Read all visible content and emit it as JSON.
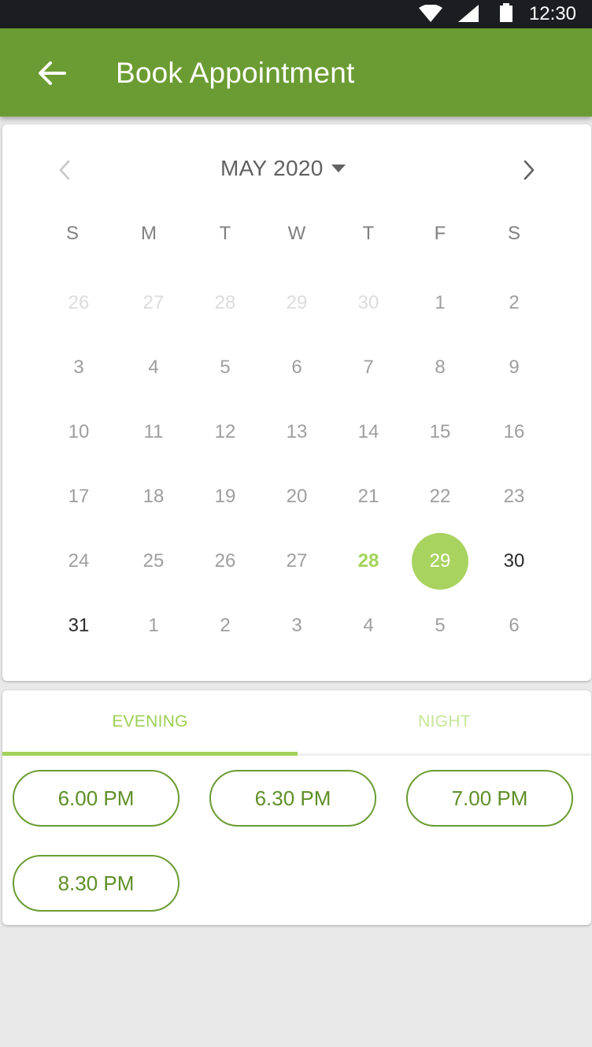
{
  "status_bar": {
    "time": "12:30",
    "icons": [
      "wifi-icon",
      "signal-icon",
      "battery-icon"
    ]
  },
  "app_bar": {
    "title": "Book Appointment",
    "back_icon": "arrow-left-icon"
  },
  "calendar": {
    "month_label": "MAY 2020",
    "weekdays": [
      "S",
      "M",
      "T",
      "W",
      "T",
      "F",
      "S"
    ],
    "weeks": [
      [
        "26",
        "27",
        "28",
        "29",
        "30",
        "1",
        "2"
      ],
      [
        "3",
        "4",
        "5",
        "6",
        "7",
        "8",
        "9"
      ],
      [
        "10",
        "11",
        "12",
        "13",
        "14",
        "15",
        "16"
      ],
      [
        "17",
        "18",
        "19",
        "20",
        "21",
        "22",
        "23"
      ],
      [
        "24",
        "25",
        "26",
        "27",
        "28",
        "29",
        "30"
      ],
      [
        "31",
        "1",
        "2",
        "3",
        "4",
        "5",
        "6"
      ]
    ],
    "today": "28",
    "selected": "29",
    "enabled_days": [
      "30",
      "31"
    ]
  },
  "tabs": [
    {
      "label": "EVENING",
      "active": true
    },
    {
      "label": "NIGHT",
      "active": false
    }
  ],
  "time_slots": [
    "6.00 PM",
    "6.30 PM",
    "7.00 PM",
    "8.30 PM"
  ],
  "colors": {
    "primary": "#6b9c33",
    "accent": "#a3d35a",
    "selected_day": "#a8d35f",
    "status_bar": "#1b1d21",
    "background": "#e9e9e9"
  }
}
